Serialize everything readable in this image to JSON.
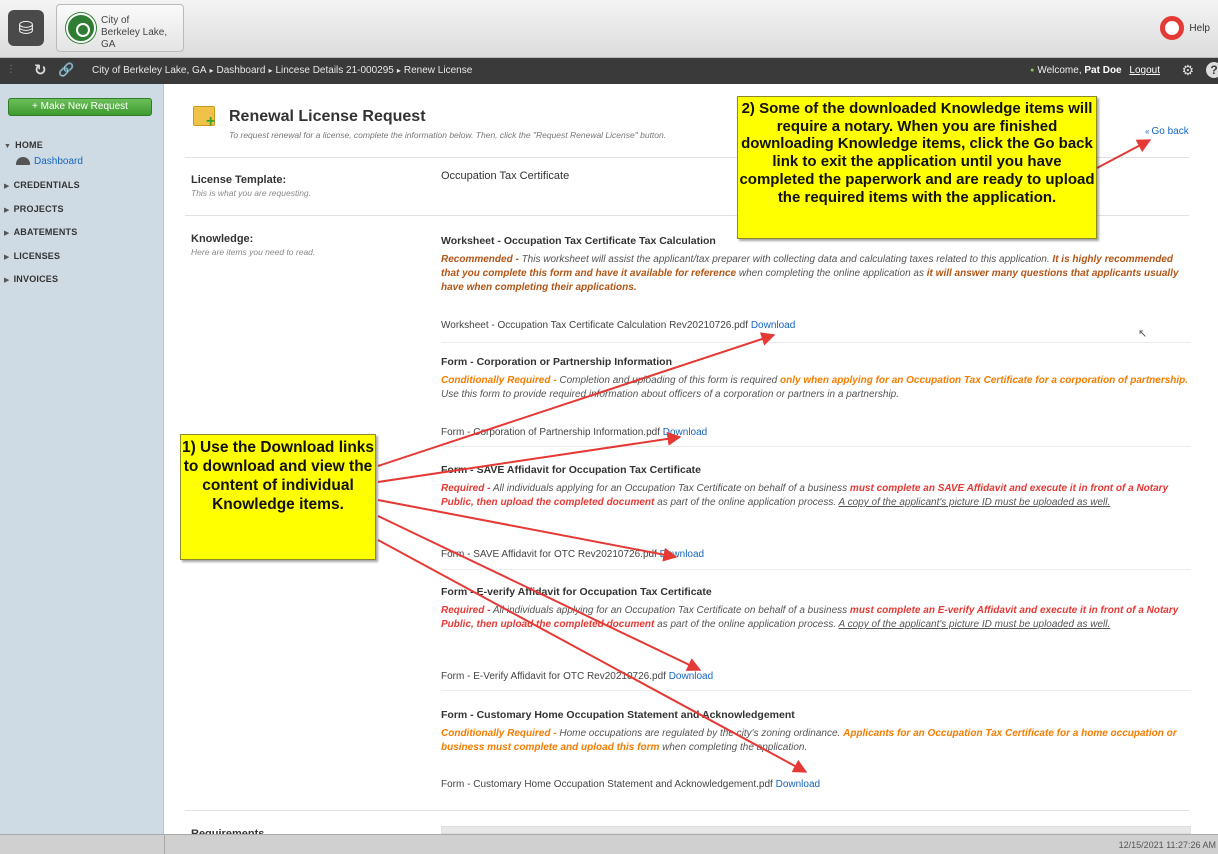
{
  "header": {
    "app_icon": "app-launcher-icon",
    "city_tab": {
      "line1": "City of",
      "line2": "Berkeley Lake, GA",
      "icon": "city-seal-icon"
    },
    "help": {
      "label": "Help",
      "icon": "lifebuoy-icon"
    }
  },
  "navbar": {
    "breadcrumb": [
      "City of Berkeley Lake, GA",
      "Dashboard",
      "Lincese Details  21-000295",
      "Renew License"
    ],
    "welcome_prefix": "Welcome,",
    "user_name": "Pat Doe",
    "logout_label": "Logout",
    "separator": "▸"
  },
  "sidebar": {
    "make_request_label": "+ Make New Request",
    "home_label": "HOME",
    "dashboard_label": "Dashboard",
    "items": [
      "CREDENTIALS",
      "PROJECTS",
      "ABATEMENTS",
      "LICENSES",
      "INVOICES"
    ]
  },
  "page": {
    "title": "Renewal License Request",
    "subtitle": "To request renewal for a license, complete the information below. Then, click the \"Request Renewal License\" button.",
    "go_back_label": "Go back",
    "template_label": "License Template:",
    "template_help": "This is what you are requesting.",
    "template_value": "Occupation Tax Certificate",
    "knowledge_label": "Knowledge:",
    "knowledge_help": "Here are items you need to read.",
    "requirements_label": "Requirements"
  },
  "knowledge": [
    {
      "title": "Worksheet - Occupation Tax Certificate Tax Calculation",
      "lead": "Recommended -",
      "parts": [
        {
          "t": " This worksheet will assist the applicant/tax preparer with collecting data and calculating taxes related to this application. ",
          "s": ""
        },
        {
          "t": "It is highly recommended that you complete this form and have it available for reference",
          "s": "brown"
        },
        {
          "t": " when completing the online application as ",
          "s": ""
        },
        {
          "t": "it will answer many questions that applicants usually have when completing their applications.",
          "s": "brown"
        }
      ],
      "file": "Worksheet - Occupation Tax Certificate Calculation Rev20210726.pdf",
      "download_label": "Download"
    },
    {
      "title": "Form - Corporation or Partnership Information",
      "lead": "Conditionally Required -",
      "parts": [
        {
          "t": " Completion and uploading of this form is required ",
          "s": ""
        },
        {
          "t": "only when applying for an Occupation Tax Certificate for a corporation of partnership.",
          "s": "orange"
        },
        {
          "t": " Use this form to provide required information about officers of a corporation or partners in a partnership.",
          "s": ""
        }
      ],
      "file": "Form - Corporation of Partnership Information.pdf",
      "download_label": "Download"
    },
    {
      "title": "Form - SAVE Affidavit for Occupation Tax Certificate",
      "lead": "Required -",
      "parts": [
        {
          "t": " All individuals applying for an Occupation Tax Certificate on behalf of a business ",
          "s": ""
        },
        {
          "t": "must complete an SAVE Affidavit and execute it in front of a Notary Public, then upload the completed document",
          "s": "red"
        },
        {
          "t": " as part of the online application process. ",
          "s": ""
        },
        {
          "t": "A copy of the applicant's picture ID must be uploaded as well.",
          "s": "u"
        }
      ],
      "file": "Form - SAVE Affidavit for OTC Rev20210726.pdf",
      "download_label": "Download"
    },
    {
      "title": "Form - E-verify Affidavit for Occupation Tax Certificate",
      "lead": "Required -",
      "parts": [
        {
          "t": " All individuals applying for an Occupation Tax Certificate on behalf of a business ",
          "s": ""
        },
        {
          "t": "must complete an E-verify Affidavit and execute it in front of a Notary Public, then upload the completed document",
          "s": "red"
        },
        {
          "t": " as part of the online application process. ",
          "s": ""
        },
        {
          "t": "A copy of the applicant's picture ID must be uploaded as well.",
          "s": "u"
        }
      ],
      "file": "Form - E-Verify Affidavit for OTC Rev20210726.pdf",
      "download_label": "Download"
    },
    {
      "title": "Form - Customary Home Occupation Statement and Acknowledgement",
      "lead": "Conditionally Required -",
      "parts": [
        {
          "t": " Home occupations are regulated by the city's zoning ordinance. ",
          "s": ""
        },
        {
          "t": "Applicants for an Occupation Tax Certificate for a home occupation or business must complete and upload this form",
          "s": "orange"
        },
        {
          "t": " when completing the application.",
          "s": ""
        }
      ],
      "file": "Form - Customary Home Occupation Statement and Acknowledgement.pdf",
      "download_label": "Download"
    }
  ],
  "annotations": {
    "callout_1": "1) Use the Download links to download and view the content of individual Knowledge items.",
    "callout_2": "2) Some of the downloaded Knowledge items will require a notary. When you are finished downloading Knowledge items, click the Go back link to exit the application until you have completed the paperwork and are ready to upload the required items with the application."
  },
  "status": {
    "timestamp": "12/15/2021 11:27:26 AM"
  },
  "colors": {
    "navbar": "#3a3a3a",
    "sidebar": "#cfdbe4",
    "callout": "#ffff00",
    "arrow": "#e53935",
    "link": "#1565c0",
    "required": "#e53935",
    "conditional": "#f57c00",
    "recommended": "#b25516"
  }
}
